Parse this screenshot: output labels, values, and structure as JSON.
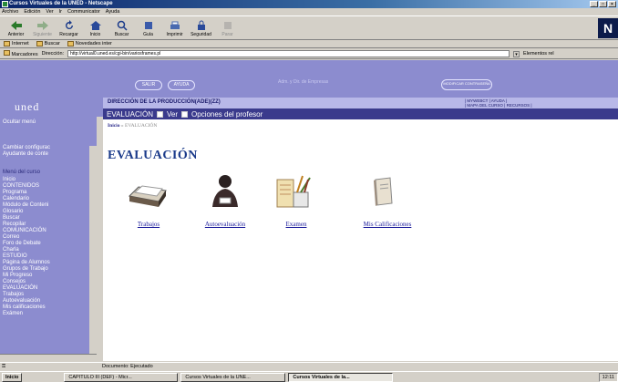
{
  "window": {
    "title": "Cursos Virtuales de la UNED - Netscape"
  },
  "menubar": [
    "Archivo",
    "Edición",
    "Ver",
    "Ir",
    "Communicator",
    "Ayuda"
  ],
  "toolbar": [
    {
      "label": "Anterior",
      "icon": "back-arrow-icon",
      "disabled": false
    },
    {
      "label": "Siguiente",
      "icon": "forward-arrow-icon",
      "disabled": true
    },
    {
      "label": "Recargar",
      "icon": "reload-icon",
      "disabled": false
    },
    {
      "label": "Inicio",
      "icon": "home-icon",
      "disabled": false
    },
    {
      "label": "Buscar",
      "icon": "search-icon",
      "disabled": false
    },
    {
      "label": "Guía",
      "icon": "guide-icon",
      "disabled": false
    },
    {
      "label": "Imprimir",
      "icon": "print-icon",
      "disabled": false
    },
    {
      "label": "Seguridad",
      "icon": "security-icon",
      "disabled": false
    },
    {
      "label": "Parar",
      "icon": "stop-icon",
      "disabled": true
    }
  ],
  "personalbar": [
    "Internet",
    "Buscar",
    "Novedades inter"
  ],
  "location": {
    "bookmarks": "Marcadores",
    "label": "Dirección:",
    "url": "http://virtual0.uned.es/cgi-bin/variosframes.pl",
    "related": "Elementos rel"
  },
  "banner": {
    "salir": "SALIR",
    "ayuda": "AYUDA",
    "center_text": "Adm. y Dir. de Empresas",
    "right_pill": "MODIFICAR CONTRASEÑA"
  },
  "header": {
    "logo": "uned",
    "title": "DIRECCIÓN DE LA PRODUCCIÓN(ADE)(ZZ)",
    "links_line1": "| MYWEBCT | AYUDA |",
    "links_line2": "| MAPA DEL CURSO | RECURSOS |",
    "section": "EVALUACIÓN",
    "view": "Ver",
    "options": "Opciones del profesor"
  },
  "sidebar": [
    {
      "label": "Ocultar menú",
      "head": false
    },
    {
      "label": "Cambiar configurac",
      "head": false
    },
    {
      "label": "Ayudante de conte",
      "head": false
    },
    {
      "label": "Menú del curso",
      "head": true
    },
    {
      "label": "Inicio",
      "head": false
    },
    {
      "label": "CONTENIDOS",
      "head": false
    },
    {
      "label": "Programa",
      "head": false
    },
    {
      "label": "Calendario",
      "head": false
    },
    {
      "label": "Módulo de Conteni",
      "head": false
    },
    {
      "label": "Glosario",
      "head": false
    },
    {
      "label": "Buscar",
      "head": false
    },
    {
      "label": "Recopilar",
      "head": false
    },
    {
      "label": "COMUNICACIÓN",
      "head": false
    },
    {
      "label": "Correo",
      "head": false
    },
    {
      "label": "Foro de Debate",
      "head": false
    },
    {
      "label": "Charla",
      "head": false
    },
    {
      "label": "ESTUDIO",
      "head": false
    },
    {
      "label": "Página de Alumnos",
      "head": false
    },
    {
      "label": "Grupos de Trabajo",
      "head": false
    },
    {
      "label": "Mi Progreso",
      "head": false
    },
    {
      "label": "Consejos",
      "head": false
    },
    {
      "label": "EVALUACIÓN",
      "head": false
    },
    {
      "label": "Trabajos",
      "head": false
    },
    {
      "label": "Autoevaluación",
      "head": false
    },
    {
      "label": "Mis calificaciones",
      "head": false
    },
    {
      "label": "Exámen",
      "head": false
    }
  ],
  "main": {
    "crumb_home": "Inicio",
    "crumb_sep": "»",
    "crumb_current": "EVALUACIÓN",
    "title": "EVALUACIÓN",
    "tools": [
      {
        "label": "Trabajos",
        "icon": "inbox-tray-icon"
      },
      {
        "label": "Autoevaluación",
        "icon": "person-icon"
      },
      {
        "label": "Examen",
        "icon": "exam-pencils-icon"
      },
      {
        "label": "Mis Calificaciones",
        "icon": "gradebook-icon"
      }
    ]
  },
  "status": "Documento: Ejecutado",
  "taskbar": {
    "start": "Inicio",
    "tasks": [
      "CAPITULO III (DEF) - Micr...",
      "Cursos Virtuales de la UNE...",
      "Cursos Virtuales de la..."
    ],
    "clock": "12:11"
  }
}
